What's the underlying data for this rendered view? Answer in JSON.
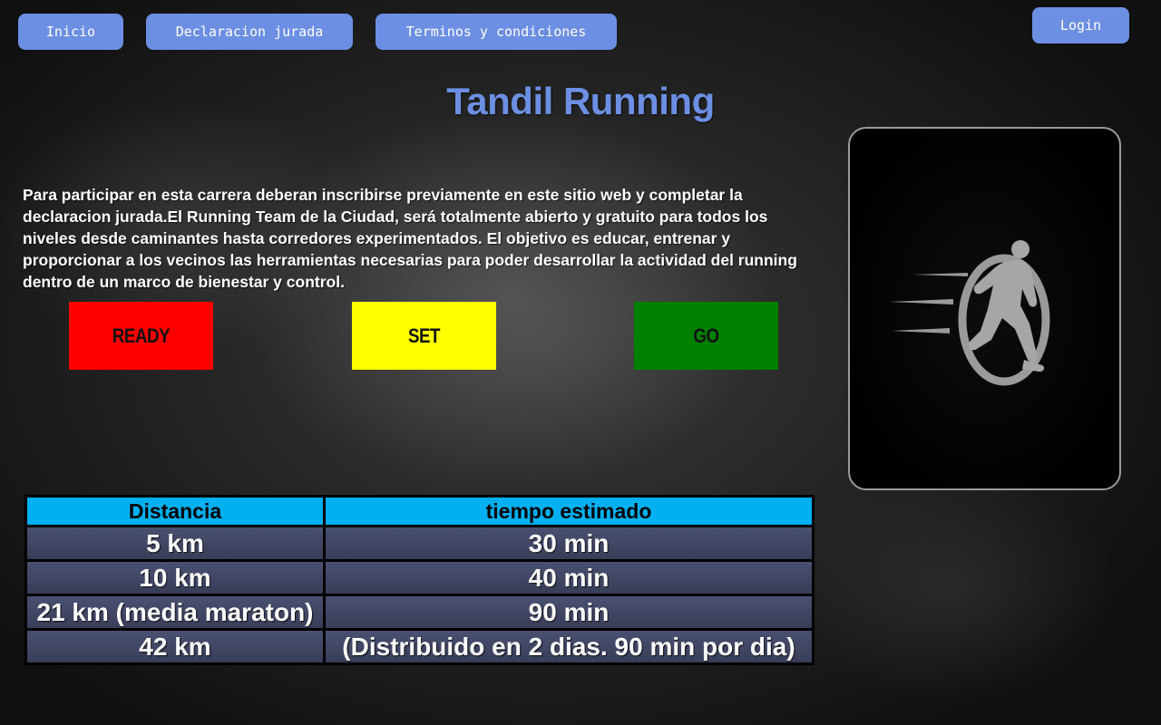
{
  "nav": {
    "inicio": "Inicio",
    "declaracion": "Declaracion jurada",
    "terminos": "Terminos y condiciones",
    "login": "Login"
  },
  "page": {
    "title": "Tandil Running",
    "intro": "Para participar en esta carrera deberan inscribirse previamente en este sitio web y completar la declaracion jurada.El Running Team de la Ciudad, será totalmente abierto y gratuito para todos los niveles desde caminantes hasta corredores experimentados. El objetivo es educar, entrenar y proporcionar a los vecinos las herramientas necesarias para poder desarrollar la actividad del running dentro de un marco de bienestar y control."
  },
  "lights": {
    "ready": "READY",
    "set": "SET",
    "go": "GO"
  },
  "colors": {
    "nav_button": "#6c8fe3",
    "title": "#6c8fe3",
    "ready": "#ff0000",
    "set": "#ffff00",
    "go": "#008000",
    "table_header": "#00b0f0",
    "table_cell": "#3e4462"
  },
  "logo": {
    "icon": "running-man-icon"
  },
  "table": {
    "headers": [
      "Distancia",
      "tiempo estimado"
    ],
    "rows": [
      [
        "5 km",
        "30 min"
      ],
      [
        "10 km",
        "40 min"
      ],
      [
        "21 km (media maraton)",
        "90 min"
      ],
      [
        "42 km",
        "(Distribuido en 2 dias. 90 min por dia)"
      ]
    ]
  }
}
